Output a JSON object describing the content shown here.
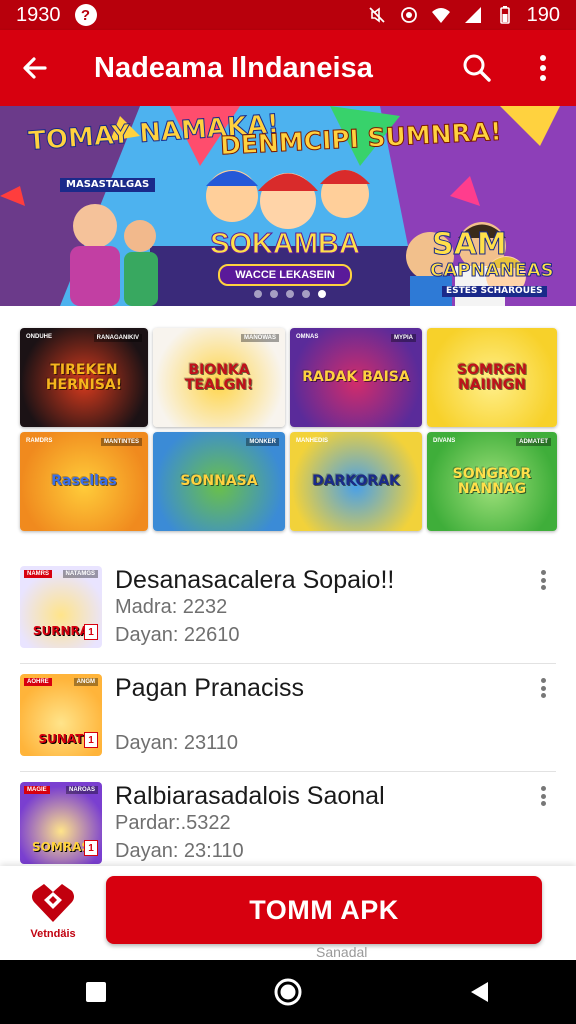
{
  "status_bar": {
    "time": "1930",
    "badge": "?",
    "battery": "190"
  },
  "app_bar": {
    "title": "Nadeama Ilndaneisa"
  },
  "banner": {
    "left_title": "TOMAY NAMAKA!",
    "left_sub": "MASASTALGAS",
    "center_title": "DENMCIPI SUMNRA!",
    "logo_title": "SOKAMBA",
    "logo_sub": "WACCE LEKASEIN",
    "right_title": "SAM",
    "right_sub": "CAPNANEAS",
    "right_tag": "ESTES SCHAROUES",
    "slide_count": 5,
    "active_slide": 4
  },
  "grid": [
    {
      "title": "TIREKEN HERNISA!",
      "tag": "ONDUHE",
      "tag_r": "RANAGANIKIV",
      "bg": "#1b1215",
      "fg": "#f6b51d",
      "glow": "#d63a1d"
    },
    {
      "title": "BIONKA TEALGN!",
      "tag": "",
      "tag_r": "MANOWAS",
      "bg": "#f8f4ee",
      "fg": "#c0111b",
      "glow": "#ffd54a"
    },
    {
      "title": "RADAK BAISA",
      "tag": "OMNAS",
      "tag_r": "MYPIA",
      "bg": "#5a2b9a",
      "fg": "#ffd23f",
      "glow": "#d22c6b"
    },
    {
      "title": "SOMRGN NAIINGN",
      "tag": "",
      "tag_r": "",
      "bg": "#f7d12a",
      "fg": "#c0111b",
      "glow": "#ffef8a"
    },
    {
      "title": "Rasellas",
      "tag": "RAMDRS",
      "tag_r": "MANTINTES",
      "bg": "#f08a1e",
      "fg": "#3a6ee8",
      "glow": "#ffcc3a"
    },
    {
      "title": "SONNASA",
      "tag": "",
      "tag_r": "MONKER",
      "bg": "#3b8bd6",
      "fg": "#ffd23f",
      "glow": "#6ac04a"
    },
    {
      "title": "DARKORAK",
      "tag": "MANHEDIS",
      "tag_r": "",
      "bg": "#f2d23a",
      "fg": "#1a2a8a",
      "glow": "#4aa0e8"
    },
    {
      "title": "SONGROR NANNAG",
      "tag": "DIVANS",
      "tag_r": "ADMATET",
      "bg": "#3fae3a",
      "fg": "#ffe04a",
      "glow": "#9ee07a"
    }
  ],
  "list": [
    {
      "title": "Desanasacalera Sopaio!!",
      "meta1": "Madra: 2232",
      "meta2": "Dayan: 22610",
      "thumb_bg": "#e9e4ff",
      "thumb_fg": "#d7000f",
      "tag": "NAMRS",
      "tag_r": "NATAMGS",
      "thumb_title": "SURNRA"
    },
    {
      "title": "Pagan Pranaciss",
      "meta1": "",
      "meta2": "Dayan: 23110",
      "thumb_bg": "#ffb43a",
      "thumb_fg": "#d7000f",
      "tag": "AOHRE",
      "tag_r": "ANGM",
      "thumb_title": "SUNAT"
    },
    {
      "title": "Ralbiarasadalois Saonal",
      "meta1": "Pardar:.5322",
      "meta2": "Dayan: 23:110",
      "thumb_bg": "#7a3fd0",
      "thumb_fg": "#ffd23f",
      "tag": "MAGIE",
      "tag_r": "NAROAS",
      "thumb_title": "SOMRAS"
    }
  ],
  "bottom": {
    "brand_label": "Vetndäis",
    "cta_label": "TOMM APK",
    "peek_text": "Sanadal"
  },
  "colors": {
    "primary": "#d7000f",
    "status": "#b8000c"
  },
  "icons": {
    "back": "arrow-left-icon",
    "search": "search-icon",
    "more": "more-vertical-icon",
    "home": "circle-home-icon",
    "recents": "square-recents-icon",
    "nav_back": "triangle-back-icon"
  }
}
